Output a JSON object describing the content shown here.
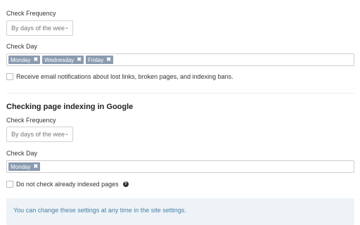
{
  "section1": {
    "frequency_label": "Check Frequency",
    "frequency_value": "By days of the wee",
    "day_label": "Check Day",
    "days": [
      "Monday",
      "Wednesday",
      "Friday"
    ],
    "email_checkbox_label": "Receive email notifications about lost links, broken pages, and indexing bans."
  },
  "section2": {
    "title": "Checking page indexing in Google",
    "frequency_label": "Check Frequency",
    "frequency_value": "By days of the wee",
    "day_label": "Check Day",
    "days": [
      "Monday"
    ],
    "indexed_checkbox_label": "Do not check already indexed pages"
  },
  "tag_remove_glyph": "✖",
  "info_text": "You can change these settings at any time in the site settings.",
  "colors": {
    "tag_bg": "#8a9bb0",
    "info_bg": "#edf3f7",
    "info_text": "#4a7fa5"
  }
}
